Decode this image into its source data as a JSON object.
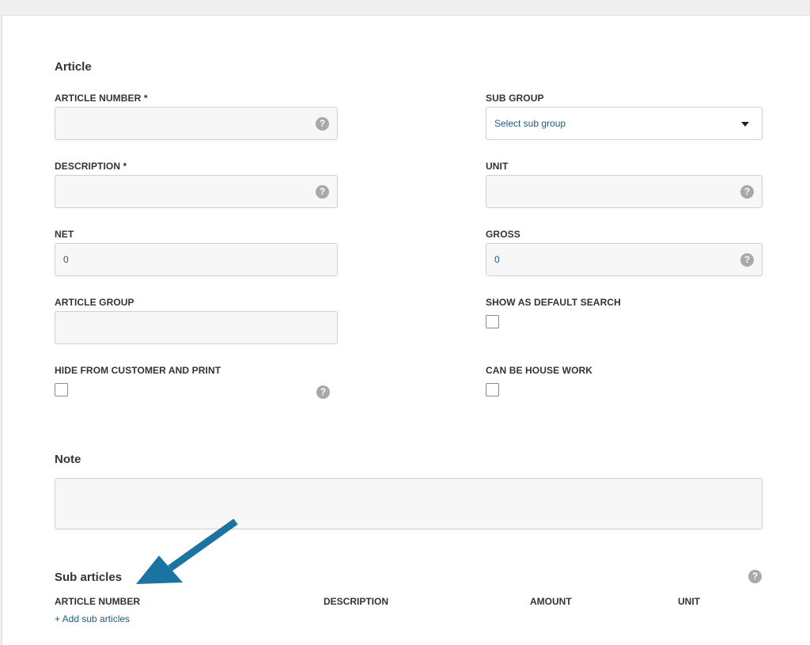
{
  "article_section": {
    "title": "Article",
    "fields": {
      "article_number": {
        "label": "ARTICLE NUMBER *",
        "value": ""
      },
      "description": {
        "label": "DESCRIPTION *",
        "value": ""
      },
      "net": {
        "label": "NET",
        "value": "0"
      },
      "article_group": {
        "label": "ARTICLE GROUP",
        "value": ""
      },
      "hide_from_customer": {
        "label": "HIDE FROM CUSTOMER AND PRINT",
        "checked": false
      },
      "sub_group": {
        "label": "SUB GROUP",
        "selected": "Select sub group"
      },
      "unit": {
        "label": "UNIT",
        "value": ""
      },
      "gross": {
        "label": "GROSS",
        "value": "0"
      },
      "show_as_default_search": {
        "label": "SHOW AS DEFAULT SEARCH",
        "checked": false
      },
      "can_be_house_work": {
        "label": "CAN BE HOUSE WORK",
        "checked": false
      }
    },
    "help_glyph": "?"
  },
  "note_section": {
    "title": "Note",
    "value": ""
  },
  "sub_articles": {
    "title": "Sub articles",
    "columns": [
      "ARTICLE NUMBER",
      "DESCRIPTION",
      "AMOUNT",
      "UNIT"
    ],
    "add_link": "+ Add sub articles",
    "help_glyph": "?"
  },
  "colors": {
    "accent": "#1f5a85",
    "arrow": "#1a73a0",
    "help_icon": "#a9a9a9"
  },
  "icons": {
    "help": "question-circle-icon",
    "dropdown": "caret-down-icon",
    "annotation": "arrow-icon"
  }
}
